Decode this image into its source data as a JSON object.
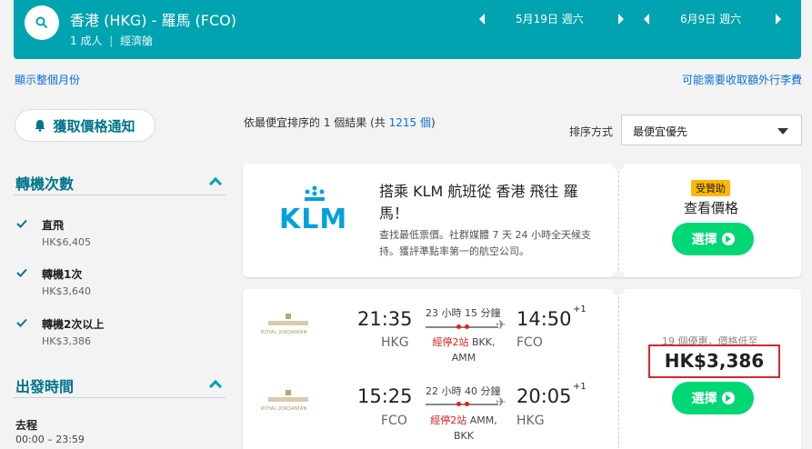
{
  "header": {
    "route": "香港 (HKG) - 羅馬 (FCO)",
    "passengers": "1 成人",
    "cabin": "經濟艙",
    "depart_date": "5月19日 週六",
    "return_date": "6月9日 週六"
  },
  "links": {
    "show_month": "顯示整個月份",
    "extra_fees": "可能需要收取額外行李費"
  },
  "sidebar": {
    "alert_button": "獲取價格通知",
    "stops_title": "轉機次數",
    "stops": [
      {
        "label": "直飛",
        "price": "HK$6,405"
      },
      {
        "label": "轉機1次",
        "price": "HK$3,640"
      },
      {
        "label": "轉機2次以上",
        "price": "HK$3,386"
      }
    ],
    "depart_title": "出發時間",
    "outbound_label": "去程",
    "outbound_range": "00:00 – 23:59"
  },
  "results": {
    "prefix": "依",
    "sort_word": "最便宜",
    "middle": "排序的 1 個結果 (共 ",
    "total": "1215 個",
    "suffix": ")",
    "sort_label": "排序方式",
    "sort_value": "最便宜優先"
  },
  "ad": {
    "logo_text": "KLM",
    "headline": "搭乘 KLM 航班從 香港 飛往 羅馬！",
    "body": "查找最低票價。社群媒體 7 天 24 小時全天候支持。獲評準點率第一的航空公司。",
    "badge": "受贊助",
    "cta_label": "查看價格",
    "select": "選擇"
  },
  "result": {
    "airline": "ROYAL JORDANIAN",
    "legs": [
      {
        "dep_time": "21:35",
        "dep_code": "HKG",
        "duration": "23 小時 15 分鐘",
        "stops": "經停2站",
        "via": "BKK,",
        "via2": "AMM",
        "arr_time": "14:50",
        "plus": "+1",
        "arr_code": "FCO"
      },
      {
        "dep_time": "15:25",
        "dep_code": "FCO",
        "duration": "22 小時 40 分鐘",
        "stops": "經停2站",
        "via": "AMM,",
        "via2": "BKK",
        "arr_time": "20:05",
        "plus": "+1",
        "arr_code": "HKG"
      }
    ],
    "deals": "19 個優惠，價格低至",
    "price": "HK$3,386",
    "select": "選擇"
  },
  "colors": {
    "brand": "#00a3b0",
    "accent_green": "#00d775",
    "link": "#0770e3",
    "highlight": "#e02020"
  }
}
